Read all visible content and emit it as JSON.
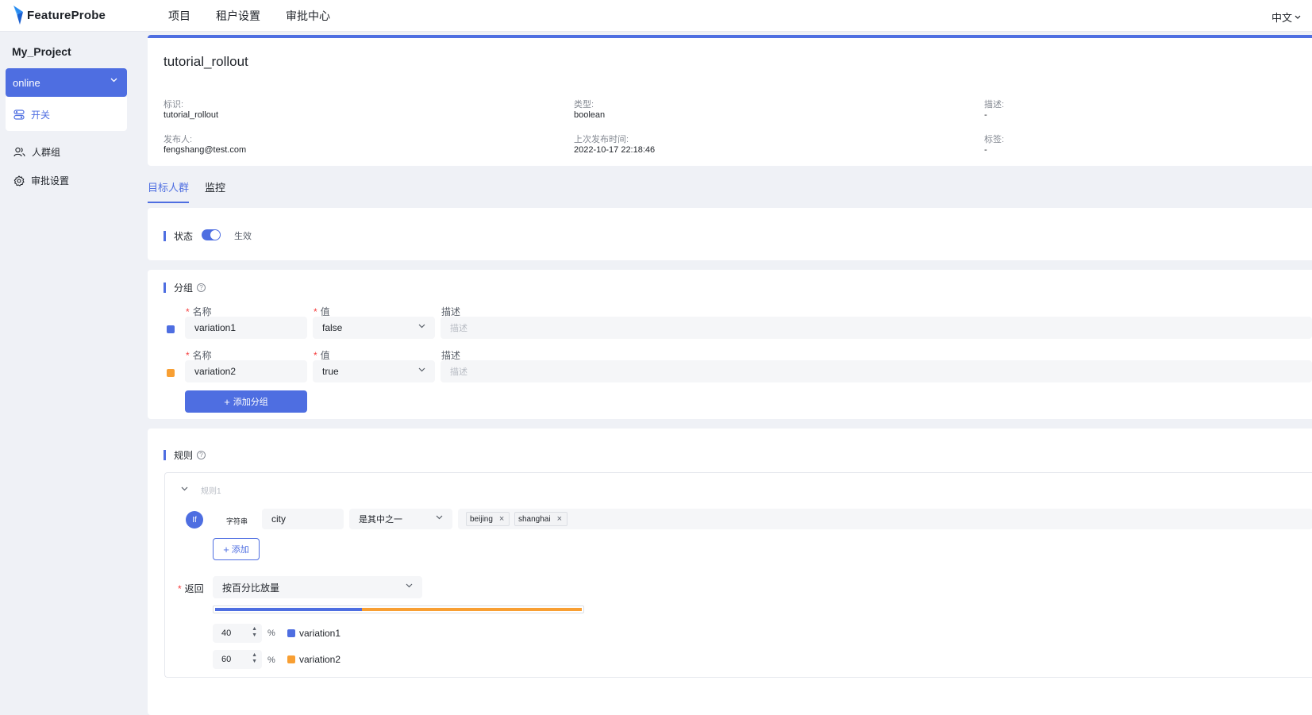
{
  "brand": {
    "name": "FeatureProbe"
  },
  "nav": {
    "items": [
      "项目",
      "租户设置",
      "审批中心"
    ],
    "lang": "中文"
  },
  "sidebar": {
    "project": "My_Project",
    "env": "online",
    "items": [
      {
        "label": "开关",
        "icon": "toggle-icon"
      },
      {
        "label": "人群组",
        "icon": "users-icon"
      },
      {
        "label": "审批设置",
        "icon": "gear-icon"
      }
    ]
  },
  "toggle_info": {
    "name": "tutorial_rollout",
    "key_label": "标识:",
    "key": "tutorial_rollout",
    "type_label": "类型:",
    "type": "boolean",
    "desc_label": "描述:",
    "desc": "-",
    "publisher_label": "发布人:",
    "publisher": "fengshang@test.com",
    "last_publish_label": "上次发布时间:",
    "last_publish": "2022-10-17 22:18:46",
    "tags_label": "标签:",
    "tags": "-"
  },
  "tabs": [
    "目标人群",
    "监控"
  ],
  "status": {
    "title": "状态",
    "enabled": true,
    "value": "生效"
  },
  "variations": {
    "title": "分组",
    "name_label": "名称",
    "value_label": "值",
    "desc_label": "描述",
    "desc_placeholder": "描述",
    "items": [
      {
        "name": "variation1",
        "value": "false",
        "color": "#4e6ee1"
      },
      {
        "name": "variation2",
        "value": "true",
        "color": "#f89f33"
      }
    ],
    "add_button": "添加分组"
  },
  "rules": {
    "title": "规则",
    "rule_name": "规则1",
    "condition": {
      "if": "If",
      "type": "字符串",
      "subject": "city",
      "operator": "是其中之一",
      "values": [
        "beijing",
        "shanghai"
      ]
    },
    "add_button": "添加",
    "return_label": "返回",
    "serve": "按百分比放量",
    "split": [
      {
        "percent": "40",
        "variation": "variation1",
        "color": "#4e6ee1"
      },
      {
        "percent": "60",
        "variation": "variation2",
        "color": "#f89f33"
      }
    ],
    "pct_sign": "%"
  }
}
